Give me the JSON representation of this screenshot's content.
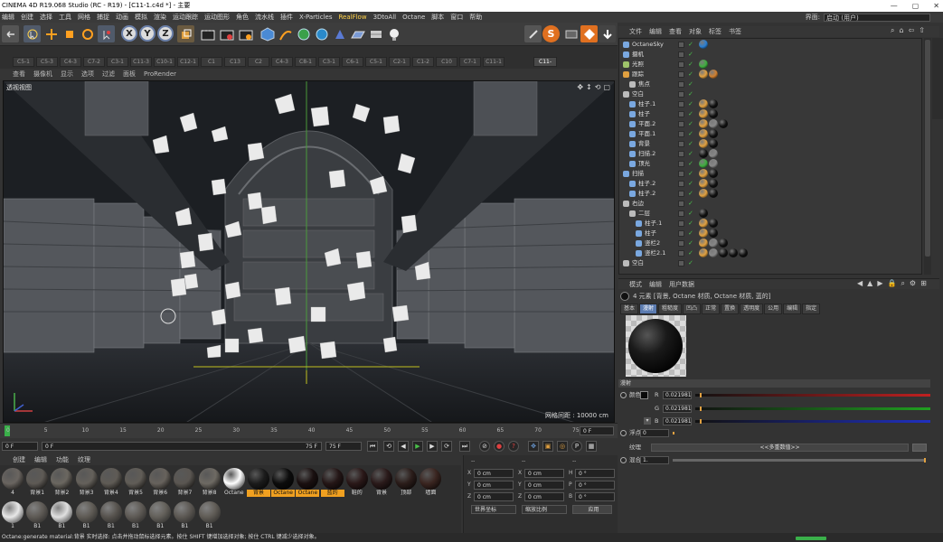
{
  "app": {
    "title": "CINEMA 4D R19.068 Studio (RC - R19) - [C11-1.c4d *] - 主要",
    "layout_label": "界面:",
    "layout_value": "启动 (用户)"
  },
  "menu": [
    "编辑",
    "创建",
    "选择",
    "工具",
    "网格",
    "捕捉",
    "动画",
    "模拟",
    "渲染",
    "运动跟踪",
    "运动图形",
    "角色",
    "流水线",
    "插件",
    "X-Particles",
    "RealFlow",
    "3DtoAll",
    "Octane",
    "脚本",
    "窗口",
    "帮助"
  ],
  "toolbar": {
    "axis_x": "X",
    "axis_y": "Y",
    "axis_z": "Z"
  },
  "file_tabs": [
    "C5-1",
    "C5-3",
    "C4-3",
    "C7-2",
    "C3-1",
    "C11-3",
    "C10-1",
    "C12-1",
    "C1",
    "C13",
    "C2",
    "C4-3",
    "C8-1",
    "C3-1",
    "C6-1",
    "C5-1",
    "C2-1",
    "C1-2",
    "C10",
    "C7-1",
    "C11-1"
  ],
  "active_tab_label": "C11-",
  "viewport_menu": [
    "查看",
    "摄像机",
    "显示",
    "选项",
    "过滤",
    "面板",
    "ProRender"
  ],
  "viewport": {
    "label": "透视视图",
    "grid_spacing": "网格间距 : 10000 cm"
  },
  "timeline": {
    "ticks": [
      "0",
      "5",
      "10",
      "15",
      "20",
      "25",
      "30",
      "35",
      "40",
      "45",
      "50",
      "55",
      "60",
      "65",
      "70",
      "75"
    ],
    "current_frame_right": "0 F"
  },
  "frame_bar": {
    "start": "0 F",
    "range_start": "0 F",
    "range_end": "75 F",
    "end": "75 F"
  },
  "material_menu": [
    "创建",
    "编辑",
    "功能",
    "纹理"
  ],
  "materials": [
    {
      "label": "4",
      "color": "#6a6560",
      "hl": false
    },
    {
      "label": "背景1",
      "color": "#5e5a55",
      "hl": false
    },
    {
      "label": "背景2",
      "color": "#6b6760",
      "hl": false
    },
    {
      "label": "背景3",
      "color": "#65615b",
      "hl": false
    },
    {
      "label": "背景4",
      "color": "#5f5b55",
      "hl": false
    },
    {
      "label": "背景5",
      "color": "#615d57",
      "hl": false
    },
    {
      "label": "背景6",
      "color": "#67625c",
      "hl": false
    },
    {
      "label": "背景7",
      "color": "#5a5651",
      "hl": false
    },
    {
      "label": "背景8",
      "color": "#6e6a63",
      "hl": false
    },
    {
      "label": "Octane",
      "color": "#ffffff",
      "hl": false
    },
    {
      "label": "背景",
      "color": "#1b1b1b",
      "hl": true
    },
    {
      "label": "Octane",
      "color": "#0c0c0c",
      "hl": true
    },
    {
      "label": "Octane",
      "color": "#1a1010",
      "hl": true
    },
    {
      "label": "蓝的",
      "color": "#241616",
      "hl": true
    },
    {
      "label": "鞋的",
      "color": "#2a1818",
      "hl": false
    },
    {
      "label": "背景",
      "color": "#2a1a1a",
      "hl": false
    },
    {
      "label": "顶部",
      "color": "#2b1d1a",
      "hl": false
    },
    {
      "label": "墙面",
      "color": "#3a2520",
      "hl": false
    }
  ],
  "materials_row2": [
    {
      "label": "1",
      "color": "#e8e8e8"
    },
    {
      "label": "B1",
      "color": "#5e5a55"
    },
    {
      "label": "B1",
      "color": "#e0e0e0"
    },
    {
      "label": "B1",
      "color": "#5f5b55"
    },
    {
      "label": "B1",
      "color": "#57534e"
    },
    {
      "label": "B1",
      "color": "#5e5a55"
    },
    {
      "label": "B1",
      "color": "#63605a"
    },
    {
      "label": "B1",
      "color": "#5c5853"
    },
    {
      "label": "B1",
      "color": "#605c56"
    }
  ],
  "coords": {
    "header": [
      "--",
      "--",
      "--"
    ],
    "rows": [
      {
        "a": "X",
        "v1": "0 cm",
        "b": "X",
        "v2": "0 cm",
        "c": "H",
        "v3": "0 °"
      },
      {
        "a": "Y",
        "v1": "0 cm",
        "b": "Y",
        "v2": "0 cm",
        "c": "P",
        "v3": "0 °"
      },
      {
        "a": "Z",
        "v1": "0 cm",
        "b": "Z",
        "v2": "0 cm",
        "c": "B",
        "v3": "0 °"
      }
    ],
    "mode1": "世界坐标",
    "mode2": "缩放比例",
    "apply": "应用"
  },
  "status_text": "Octane:generate material:背景      实时选择: 点击并拖动鼠标选择元素。按住 SHIFT 键增加选择对象; 按住 CTRL 键减少选择对象。",
  "object_menu": [
    "文件",
    "编辑",
    "查看",
    "对象",
    "标签",
    "书签"
  ],
  "objects": [
    {
      "name": "OctaneSky",
      "indent": 0,
      "icon": "#7aa8e0",
      "tags": [
        "#2a7fd4"
      ]
    },
    {
      "name": "摄机",
      "indent": 0,
      "icon": "#7aa8e0",
      "tags": []
    },
    {
      "name": "光照",
      "indent": 0,
      "icon": "#9ec36a",
      "tags": [
        "#3fae3f"
      ]
    },
    {
      "name": "跟踪",
      "indent": 0,
      "icon": "#e0a040",
      "tags": [
        "#e0a040",
        "#d08030"
      ]
    },
    {
      "name": "焦点",
      "indent": 1,
      "icon": "#bbbbbb",
      "tags": []
    },
    {
      "name": "空白",
      "indent": 0,
      "icon": "#bbbbbb",
      "tags": []
    },
    {
      "name": "柱子.1",
      "indent": 1,
      "icon": "#7aa8e0",
      "tags": [
        "#e0a040",
        "#111111"
      ]
    },
    {
      "name": "柱子",
      "indent": 1,
      "icon": "#7aa8e0",
      "tags": [
        "#e0a040",
        "#111111"
      ]
    },
    {
      "name": "平面.2",
      "indent": 1,
      "icon": "#7aa8e0",
      "tags": [
        "#e0a040",
        "#888888",
        "#111111"
      ]
    },
    {
      "name": "平面.1",
      "indent": 1,
      "icon": "#7aa8e0",
      "tags": [
        "#e0a040",
        "#111111"
      ]
    },
    {
      "name": "背景",
      "indent": 1,
      "icon": "#7aa8e0",
      "tags": [
        "#e0a040",
        "#111111"
      ]
    },
    {
      "name": "扫描.2",
      "indent": 1,
      "icon": "#7aa8e0",
      "tags": [
        "#111111",
        "#888888"
      ]
    },
    {
      "name": "顶光",
      "indent": 1,
      "icon": "#7aa8e0",
      "tags": [
        "#3fae3f",
        "#888888"
      ]
    },
    {
      "name": "扫描",
      "indent": 0,
      "icon": "#7aa8e0",
      "tags": [
        "#e0a040",
        "#111111"
      ]
    },
    {
      "name": "柱子.2",
      "indent": 1,
      "icon": "#7aa8e0",
      "tags": [
        "#e0a040",
        "#111111"
      ]
    },
    {
      "name": "柱子.2",
      "indent": 1,
      "icon": "#7aa8e0",
      "tags": [
        "#e0a040",
        "#111111"
      ]
    },
    {
      "name": "右边",
      "indent": 0,
      "icon": "#bbbbbb",
      "tags": []
    },
    {
      "name": "二层",
      "indent": 1,
      "icon": "#bbbbbb",
      "tags": [
        "#111111"
      ]
    },
    {
      "name": "柱子.1",
      "indent": 2,
      "icon": "#7aa8e0",
      "tags": [
        "#e0a040",
        "#111111"
      ]
    },
    {
      "name": "柱子",
      "indent": 2,
      "icon": "#7aa8e0",
      "tags": [
        "#e0a040",
        "#111111"
      ]
    },
    {
      "name": "竖栏2",
      "indent": 2,
      "icon": "#7aa8e0",
      "tags": [
        "#e0a040",
        "#888888",
        "#111111"
      ]
    },
    {
      "name": "竖栏2.1",
      "indent": 2,
      "icon": "#7aa8e0",
      "tags": [
        "#e0a040",
        "#888888",
        "#111111",
        "#111111",
        "#111111"
      ]
    },
    {
      "name": "空白",
      "indent": 0,
      "icon": "#bbbbbb",
      "tags": []
    }
  ],
  "attr": {
    "menu": [
      "模式",
      "编辑",
      "用户数据"
    ],
    "header": "4 元素 [背景, Octane 材质, Octane 材质, 蓝的]",
    "tabs": [
      "基本",
      "漫射",
      "粗糙度",
      "凹凸",
      "正常",
      "置换",
      "透明度",
      "公用",
      "编辑",
      "指定"
    ],
    "active_tab": "漫射",
    "section": "漫射",
    "color_label": "颜色",
    "r_label": "R",
    "r_value": "0.021981",
    "g_label": "G",
    "g_value": "0.021981",
    "b_label": "B",
    "b_value": "0.021981",
    "float_label": "浮点",
    "float_value": "0",
    "texture_label": "纹理",
    "texture_value": "<<多重数值>>",
    "mix_label": "混合",
    "mix_value": "1.",
    "slider_r": "#c02020",
    "slider_g": "#20a020",
    "slider_b": "#2030c0",
    "r_level": 0.02,
    "g_level": 0.02,
    "b_level": 0.02
  }
}
